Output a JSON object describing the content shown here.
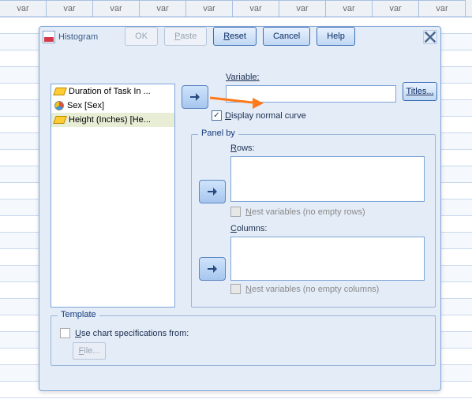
{
  "sheet": {
    "col_header": "var",
    "col_count": 10,
    "row_count": 23
  },
  "dialog": {
    "title": "Histogram",
    "variable_list": [
      {
        "icon": "ruler",
        "label": "Duration of Task In ...",
        "selected": false
      },
      {
        "icon": "nominal",
        "label": "Sex [Sex]",
        "selected": false
      },
      {
        "icon": "ruler",
        "label": "Height (Inches) [He...",
        "selected": true
      }
    ],
    "variable_label": "Variable:",
    "variable_value": "",
    "titles_button": "Titles...",
    "display_normal_curve_label": "Display normal curve",
    "display_normal_curve_checked": true,
    "panel_by": {
      "legend": "Panel by",
      "rows_label": "Rows:",
      "rows_value": "",
      "nest_rows_label": "Nest variables (no empty rows)",
      "nest_rows_checked": false,
      "columns_label": "Columns:",
      "columns_value": "",
      "nest_cols_label": "Nest variables (no empty columns)",
      "nest_cols_checked": false
    },
    "template": {
      "legend": "Template",
      "use_chart_spec_label": "Use chart specifications from:",
      "use_chart_spec_checked": false,
      "file_button": "File..."
    },
    "buttons": {
      "ok": "OK",
      "paste": "Paste",
      "reset": "Reset",
      "cancel": "Cancel",
      "help": "Help"
    }
  }
}
